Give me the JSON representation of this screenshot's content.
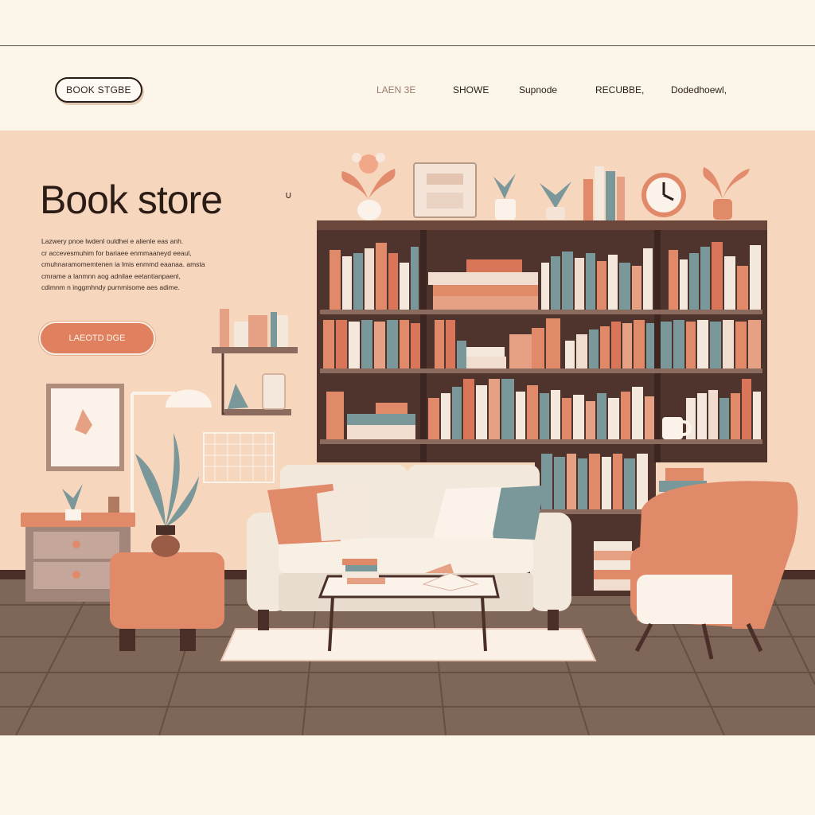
{
  "brand": {
    "logo_text": "BOOK STGBE"
  },
  "nav": {
    "links": [
      {
        "label": "LAEN 3E"
      },
      {
        "label": "SHOWE"
      },
      {
        "label": "Supnode"
      },
      {
        "label": "RECUBBE,"
      },
      {
        "label": "Dodedhoewl,"
      }
    ]
  },
  "hero": {
    "title": "Book store",
    "caret": "∪",
    "body_lines": [
      "Lazwery pnoe lwdenl ouldhei e alienle eas anh.",
      "cr accevesmuhim for bariaee enmmaaneyd eeaul,",
      "cmuhnaramomemtenen ia lmis enmmd eaanaa. amsta",
      "cmrame a lanmnn aog adnilae eetantianpaenl,",
      "cdimnm n inggmhndy purnmisome aes adime."
    ],
    "cta_label": "LAEOTD DGE"
  },
  "colors": {
    "cream": "#fbf5ea",
    "peach_wall": "#f6d6bd",
    "terracotta": "#e0805f",
    "shelf_wood": "#5b3b31",
    "teal_book": "#7a9799",
    "floor": "#7e6658",
    "sofa": "#f2e8dc"
  },
  "icons": {
    "clock": "clock-icon",
    "plant": "potted-plant-icon",
    "lamp": "desk-lamp-icon",
    "mug": "mug-icon",
    "picture": "framed-picture-icon"
  }
}
